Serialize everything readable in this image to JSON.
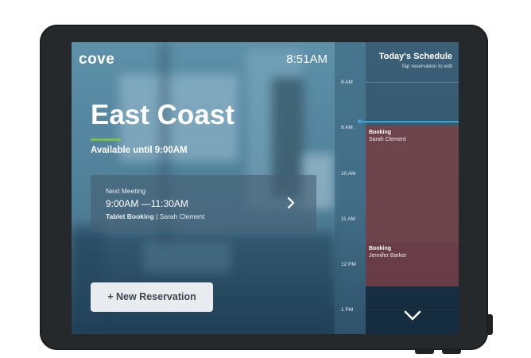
{
  "app": {
    "brand": "cove",
    "clock": "8:51AM"
  },
  "room": {
    "name": "East Coast",
    "availability": "Available until 9:00AM",
    "accent_color": "#7bc043"
  },
  "next_meeting": {
    "heading": "Next Meeting",
    "time": "9:00AM —11:30AM",
    "title": "Tablet Booking",
    "separator": " | ",
    "organizer": "Sarah Clement",
    "icon": "chevron-right-icon"
  },
  "actions": {
    "new_reservation_label": "+ New Reservation"
  },
  "schedule": {
    "title": "Today's Schedule",
    "subtitle": "Tap reservation to edit",
    "hours": [
      "8 AM",
      "9 AM",
      "10 AM",
      "11 AM",
      "12 PM",
      "1 PM"
    ],
    "bookings": [
      {
        "title": "Booking",
        "name": "Sarah Clement",
        "color": "#744248"
      },
      {
        "title": "Booking",
        "name": "Jennifer Barker",
        "color": "#6e3c44"
      }
    ],
    "current_time_color": "#3aa6d8",
    "scroll_icon": "chevron-down-icon"
  }
}
